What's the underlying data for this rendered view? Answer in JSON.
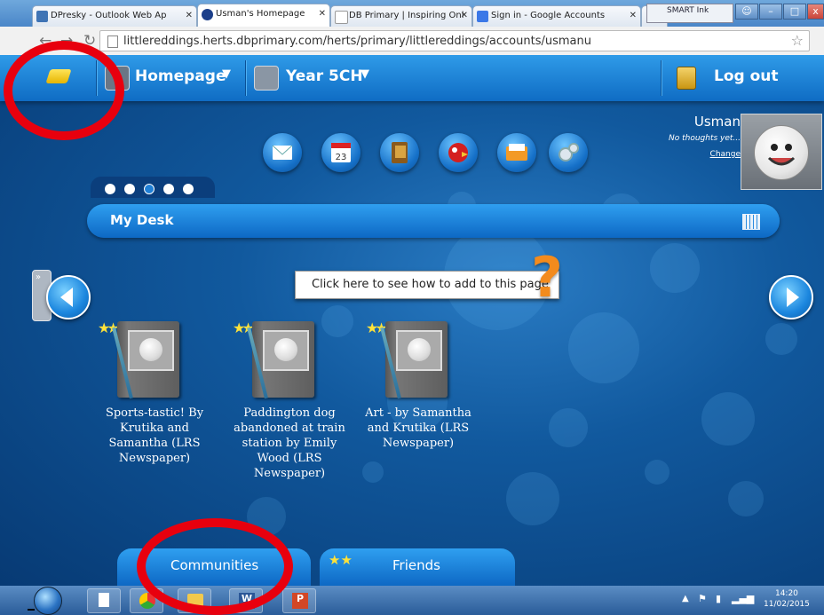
{
  "browser": {
    "tabs": [
      {
        "label": "DPresky - Outlook Web Ap",
        "active": false
      },
      {
        "label": "Usman's Homepage",
        "active": true
      },
      {
        "label": "DB Primary | Inspiring Onl",
        "active": false
      },
      {
        "label": "Sign in - Google Accounts",
        "active": false
      }
    ],
    "smart_ink_label": "SMART Ink",
    "url": "littlereddings.herts.dbprimary.com/herts/primary/littlereddings/accounts/usmanu"
  },
  "site": {
    "nav": {
      "homepage_label": "Homepage",
      "class_label": "Year 5CH",
      "logout_label": "Log out"
    },
    "profile": {
      "name": "Usman",
      "status": "No thoughts yet...",
      "change_label": "Change"
    },
    "dock_icons": [
      "mail-icon",
      "calendar-icon",
      "book-icon",
      "parrot-icon",
      "folder-icon",
      "settings-icon"
    ],
    "calendar_day": "23",
    "desk_title": "My Desk",
    "help_text": "Click here to see how to add to this page",
    "books": [
      {
        "title": "Sports-tastic! By Krutika and Samantha (LRS Newspaper)"
      },
      {
        "title": "Paddington dog abandoned at train station by Emily Wood (LRS Newspaper)"
      },
      {
        "title": "Art - by Samantha and Krutika (LRS Newspaper)"
      }
    ],
    "bottom_tabs": {
      "communities_label": "Communities",
      "friends_label": "Friends"
    }
  },
  "taskbar": {
    "apps": [
      "file-icon",
      "chrome-icon",
      "explorer-folder-icon",
      "word-icon",
      "powerpoint-icon"
    ],
    "time": "14:20",
    "date": "11/02/2015"
  },
  "colors": {
    "site_blue": "#0f6cc4",
    "annotation_red": "#e8000e",
    "help_orange": "#f38b1d"
  }
}
